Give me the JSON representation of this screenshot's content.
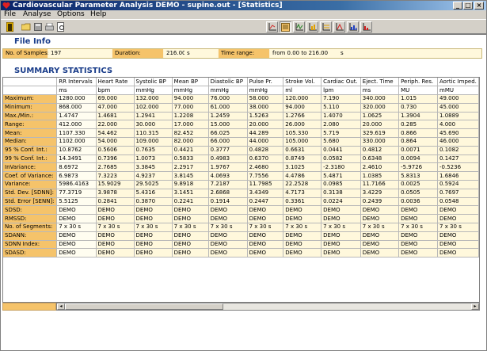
{
  "window": {
    "title": "Cardiovascular Parameter Analysis DEMO - supine.out - [Statistics]",
    "minimize": "_",
    "maximize": "□",
    "close": "×"
  },
  "menu": [
    "File",
    "Analyse",
    "Options",
    "Help"
  ],
  "toolbar": {
    "left_icons": [
      "exit-door-icon",
      "open-folder-icon",
      "save-disk-icon",
      "print-icon",
      "print-preview-icon"
    ],
    "view_icons": [
      "chart-view-1-icon",
      "statistics-view-icon",
      "chart-view-3-icon",
      "chart-view-4-icon",
      "chart-view-5-icon",
      "chart-view-6-icon",
      "chart-view-7-icon",
      "chart-view-8-icon"
    ],
    "active_view": 1
  },
  "file_info": {
    "heading": "File Info",
    "samples_label": "No. of Samples:",
    "samples_value": "197",
    "duration_label": "Duration:",
    "duration_value": "216.00",
    "duration_unit": "s",
    "range_label": "Time range:",
    "range_value": "from 0.00 to 216.00",
    "range_unit": "s"
  },
  "summary": {
    "heading": "SUMMARY STATISTICS",
    "columns": [
      "RR Intervals",
      "Heart Rate",
      "Systolic BP",
      "Mean BP",
      "Diastolic BP",
      "Pulse Pr.",
      "Stroke Vol.",
      "Cardiac Out.",
      "Eject. Time",
      "Periph. Res.",
      "Aortic Imped."
    ],
    "units": [
      "ms",
      "bpm",
      "mmHg",
      "mmHg",
      "mmHg",
      "mmHg",
      "ml",
      "lpm",
      "ms",
      "MU",
      "mMU"
    ],
    "rows": [
      {
        "label": "Maximum:",
        "values": [
          "1280.000",
          "69.000",
          "132.000",
          "94.000",
          "76.000",
          "58.000",
          "120.000",
          "7.190",
          "340.000",
          "1.015",
          "49.000"
        ]
      },
      {
        "label": "Minimum:",
        "values": [
          "868.000",
          "47.000",
          "102.000",
          "77.000",
          "61.000",
          "38.000",
          "94.000",
          "5.110",
          "320.000",
          "0.730",
          "45.000"
        ]
      },
      {
        "label": "Max./Min.:",
        "values": [
          "1.4747",
          "1.4681",
          "1.2941",
          "1.2208",
          "1.2459",
          "1.5263",
          "1.2766",
          "1.4070",
          "1.0625",
          "1.3904",
          "1.0889"
        ]
      },
      {
        "label": "Range:",
        "values": [
          "412.000",
          "22.000",
          "30.000",
          "17.000",
          "15.000",
          "20.000",
          "26.000",
          "2.080",
          "20.000",
          "0.285",
          "4.000"
        ]
      },
      {
        "label": "Mean:",
        "values": [
          "1107.330",
          "54.462",
          "110.315",
          "82.452",
          "66.025",
          "44.289",
          "105.330",
          "5.719",
          "329.619",
          "0.866",
          "45.690"
        ]
      },
      {
        "label": "Median:",
        "values": [
          "1102.000",
          "54.000",
          "109.000",
          "82.000",
          "66.000",
          "44.000",
          "105.000",
          "5.680",
          "330.000",
          "0.864",
          "46.000"
        ]
      },
      {
        "label": "95 % Conf. Int.:",
        "values": [
          "10.8762",
          "0.5606",
          "0.7635",
          "0.4421",
          "0.3777",
          "0.4828",
          "0.6631",
          "0.0441",
          "0.4812",
          "0.0071",
          "0.1082"
        ]
      },
      {
        "label": "99 % Conf. Int.:",
        "values": [
          "14.3491",
          "0.7396",
          "1.0073",
          "0.5833",
          "0.4983",
          "0.6370",
          "0.8749",
          "0.0582",
          "0.6348",
          "0.0094",
          "0.1427"
        ]
      },
      {
        "label": "InVariance:",
        "values": [
          "8.6972",
          "2.7685",
          "3.3845",
          "2.2917",
          "1.9767",
          "2.4680",
          "3.1025",
          "-2.3180",
          "2.4610",
          "-5.9726",
          "-0.5236"
        ]
      },
      {
        "label": "Coef. of Variance:",
        "values": [
          "6.9873",
          "7.3223",
          "4.9237",
          "3.8145",
          "4.0693",
          "7.7556",
          "4.4786",
          "5.4871",
          "1.0385",
          "5.8313",
          "1.6846"
        ]
      },
      {
        "label": "Variance:",
        "values": [
          "5986.4163",
          "15.9029",
          "29.5025",
          "9.8918",
          "7.2187",
          "11.7985",
          "22.2528",
          "0.0985",
          "11.7166",
          "0.0025",
          "0.5924"
        ]
      },
      {
        "label": "Std. Dev. [SDNN]:",
        "values": [
          "77.3719",
          "3.9878",
          "5.4316",
          "3.1451",
          "2.6868",
          "3.4349",
          "4.7173",
          "0.3138",
          "3.4229",
          "0.0505",
          "0.7697"
        ]
      },
      {
        "label": "Std. Error [SENN]:",
        "values": [
          "5.5125",
          "0.2841",
          "0.3870",
          "0.2241",
          "0.1914",
          "0.2447",
          "0.3361",
          "0.0224",
          "0.2439",
          "0.0036",
          "0.0548"
        ]
      },
      {
        "label": "SDSD:",
        "values": [
          "DEMO",
          "DEMO",
          "DEMO",
          "DEMO",
          "DEMO",
          "DEMO",
          "DEMO",
          "DEMO",
          "DEMO",
          "DEMO",
          "DEMO"
        ]
      },
      {
        "label": "RMSSD:",
        "values": [
          "DEMO",
          "DEMO",
          "DEMO",
          "DEMO",
          "DEMO",
          "DEMO",
          "DEMO",
          "DEMO",
          "DEMO",
          "DEMO",
          "DEMO"
        ]
      },
      {
        "label": "No. of Segments:",
        "values": [
          "7 x 30  s",
          "7 x 30  s",
          "7 x 30  s",
          "7 x 30  s",
          "7 x 30  s",
          "7 x 30  s",
          "7 x 30  s",
          "7 x 30  s",
          "7 x 30  s",
          "7 x 30  s",
          "7 x 30  s"
        ]
      },
      {
        "label": "SDANN:",
        "values": [
          "DEMO",
          "DEMO",
          "DEMO",
          "DEMO",
          "DEMO",
          "DEMO",
          "DEMO",
          "DEMO",
          "DEMO",
          "DEMO",
          "DEMO"
        ]
      },
      {
        "label": "SDNN Index:",
        "values": [
          "DEMO",
          "DEMO",
          "DEMO",
          "DEMO",
          "DEMO",
          "DEMO",
          "DEMO",
          "DEMO",
          "DEMO",
          "DEMO",
          "DEMO"
        ]
      },
      {
        "label": "SDASD:",
        "values": [
          "DEMO",
          "DEMO",
          "DEMO",
          "DEMO",
          "DEMO",
          "DEMO",
          "DEMO",
          "DEMO",
          "DEMO",
          "DEMO",
          "DEMO"
        ]
      }
    ]
  },
  "colors": {
    "title_gradient_start": "#0a246a",
    "label_orange": "#f5c36a",
    "cell_cream": "#fff8dc",
    "heading_blue": "#1a3d8a"
  }
}
